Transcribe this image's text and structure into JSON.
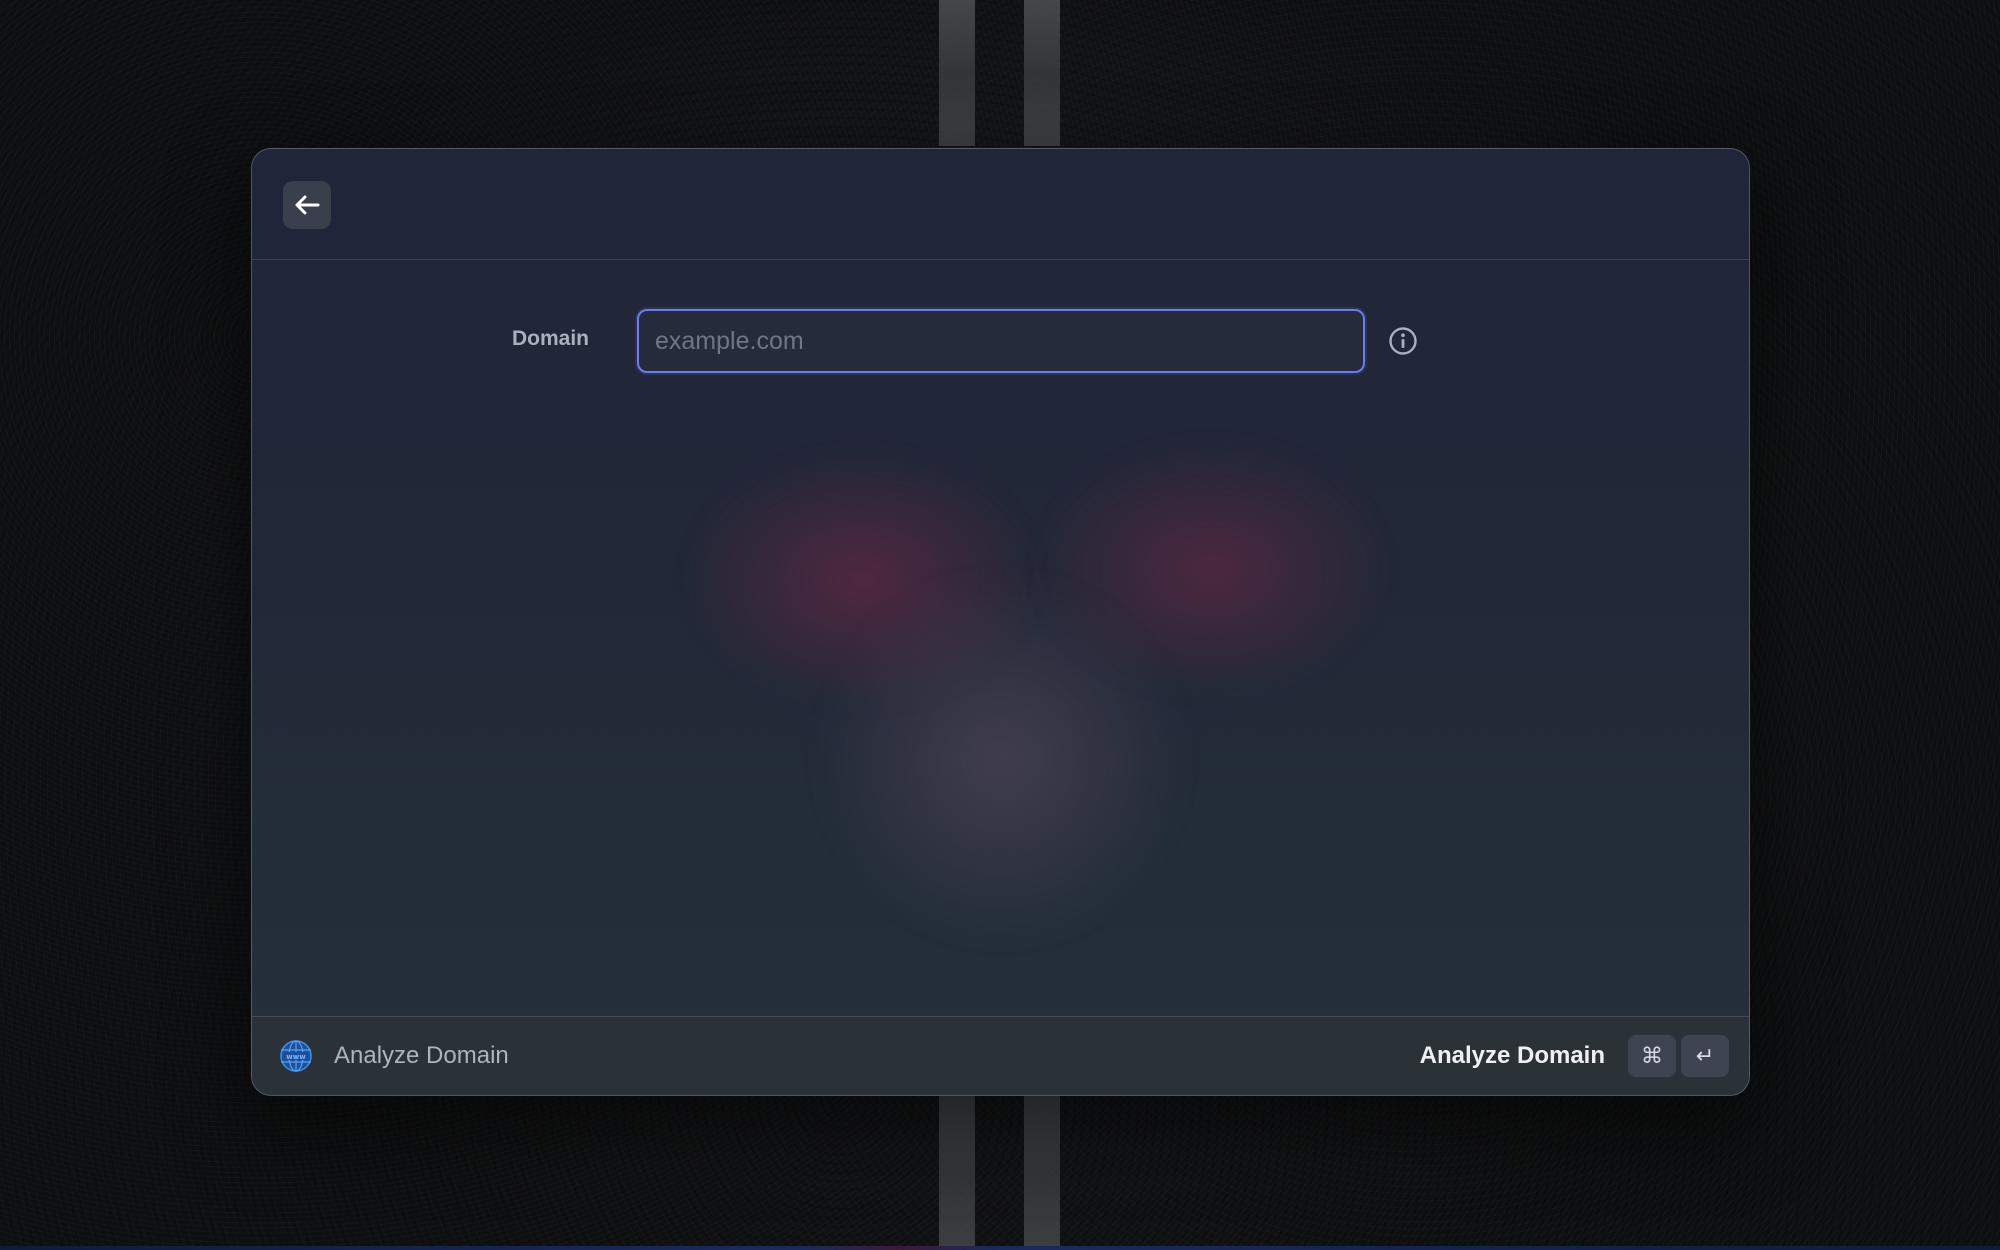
{
  "form": {
    "domain_label": "Domain",
    "domain_value": "",
    "domain_placeholder": "example.com"
  },
  "footer": {
    "title": "Analyze Domain",
    "title_icon": "globe-www-icon",
    "action_label": "Analyze Domain",
    "shortcut_keys": [
      "⌘",
      "↵"
    ]
  },
  "header": {
    "back_icon": "arrow-left-icon"
  },
  "colors": {
    "focus_ring": "#6b7bf0",
    "window_bg": "#20253a",
    "globe_blue": "#2f7fe0"
  }
}
